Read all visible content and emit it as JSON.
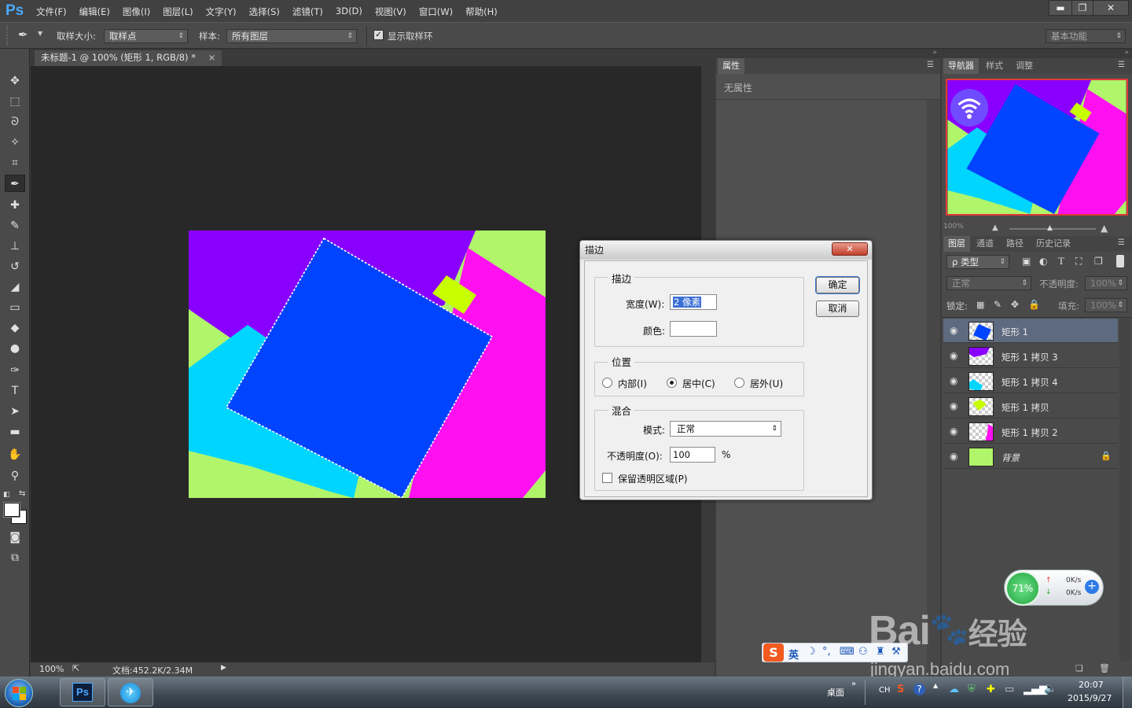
{
  "app": {
    "logo": "Ps",
    "window_buttons": [
      "▬",
      "❐",
      "✕"
    ]
  },
  "menu": [
    "文件(F)",
    "编辑(E)",
    "图像(I)",
    "图层(L)",
    "文字(Y)",
    "选择(S)",
    "滤镜(T)",
    "3D(D)",
    "视图(V)",
    "窗口(W)",
    "帮助(H)"
  ],
  "options": {
    "sample_size_label": "取样大小:",
    "sample_size_value": "取样点",
    "sample_label": "样本:",
    "sample_value": "所有图层",
    "show_ring_label": "显示取样环",
    "workspace": "基本功能"
  },
  "document": {
    "tab_title": "未标题-1 @ 100% (矩形 1, RGB/8) *",
    "tab_close": "×",
    "zoom": "100%",
    "doc_info": "文档:452.2K/2.34M"
  },
  "properties": {
    "tab": "属性",
    "empty": "无属性"
  },
  "navigator": {
    "tabs": [
      "导航器",
      "样式",
      "调整"
    ],
    "zoom": "100%"
  },
  "layers_panel": {
    "tabs": [
      "图层",
      "通道",
      "路径",
      "历史记录"
    ],
    "filter_kind": "ρ 类型",
    "blend_mode": "正常",
    "opacity_label": "不透明度:",
    "opacity_value": "100%",
    "lock_label": "锁定:",
    "fill_label": "填充:",
    "fill_value": "100%",
    "layers": [
      {
        "name": "矩形 1",
        "color": "#0044ff",
        "selected": true
      },
      {
        "name": "矩形 1 拷贝 3",
        "color": "#8a00ff",
        "selected": false
      },
      {
        "name": "矩形 1 拷贝 4",
        "color": "#00d5ff",
        "selected": false
      },
      {
        "name": "矩形 1 拷贝",
        "color": "#c8ff00",
        "selected": false
      },
      {
        "name": "矩形 1 拷贝 2",
        "color": "#ff10f0",
        "selected": false
      },
      {
        "name": "背景",
        "color": "#b0f56a",
        "selected": false
      }
    ]
  },
  "dialog": {
    "title": "描边",
    "close": "✕",
    "stroke_group": "描边",
    "width_label": "宽度(W):",
    "width_value": "2 像素",
    "color_label": "颜色:",
    "position_group": "位置",
    "pos_inside": "内部(I)",
    "pos_center": "居中(C)",
    "pos_outside": "居外(U)",
    "blend_group": "混合",
    "mode_label": "模式:",
    "mode_value": "正常",
    "opacity_label": "不透明度(O):",
    "opacity_value": "100",
    "percent": "%",
    "preserve_label": "保留透明区域(P)",
    "ok": "确定",
    "cancel": "取消"
  },
  "speed_widget": {
    "percent": "71%",
    "up": "0K/s",
    "down": "0K/s"
  },
  "ime": {
    "lang": "英"
  },
  "taskbar": {
    "desktop": "桌面",
    "lang": "CH",
    "time": "20:07",
    "date": "2015/9/27"
  },
  "watermark": {
    "brand": "Bai",
    "brand2": "经验",
    "url": "jingyan.baidu.com"
  },
  "colors": {
    "accent": "#4aa9ff",
    "bg": "#b0f56a",
    "purple": "#8a00ff",
    "magenta": "#ff10f0",
    "cyan": "#00d5ff",
    "lime": "#c8ff00",
    "blue": "#0044ff"
  }
}
